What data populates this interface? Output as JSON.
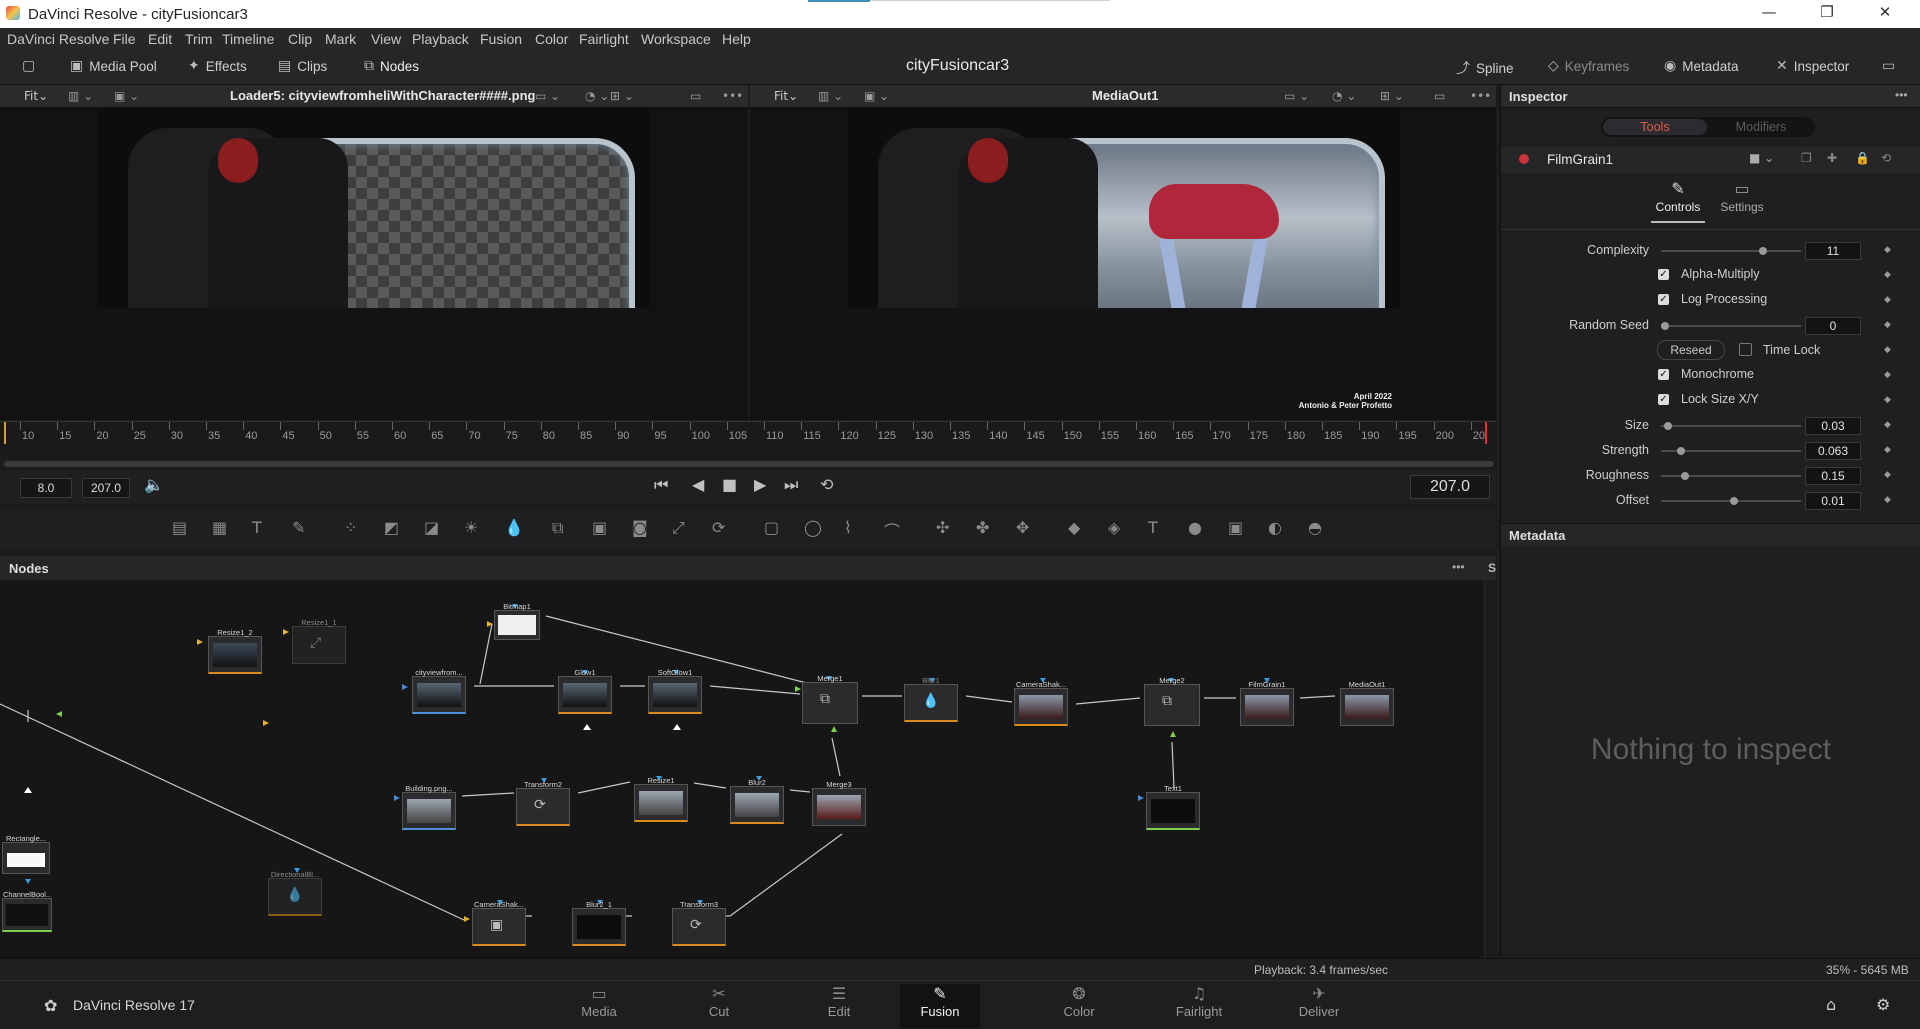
{
  "window": {
    "title": "DaVinci Resolve - cityFusioncar3",
    "minimize": "—",
    "restore": "❐",
    "close": "✕"
  },
  "menu": [
    "DaVinci Resolve",
    "File",
    "Edit",
    "Trim",
    "Timeline",
    "Clip",
    "Mark",
    "View",
    "Playback",
    "Fusion",
    "Color",
    "Fairlight",
    "Workspace",
    "Help"
  ],
  "toolbar": {
    "media_pool": "Media Pool",
    "effects": "Effects",
    "clips": "Clips",
    "nodes": "Nodes",
    "project": "cityFusioncar3",
    "spline": "Spline",
    "keyframes": "Keyframes",
    "metadata": "Metadata",
    "inspector": "Inspector"
  },
  "viewer_left": {
    "fit": "Fit",
    "name": "Loader5: cityviewfromheliWithCharacter####.png"
  },
  "viewer_right": {
    "fit": "Fit",
    "name": "MediaOut1",
    "overlay_line1": "April 2022",
    "overlay_line2": "Antonio & Peter Profetto"
  },
  "ruler": {
    "ticks": [
      "10",
      "15",
      "20",
      "25",
      "30",
      "35",
      "40",
      "45",
      "50",
      "55",
      "60",
      "65",
      "70",
      "75",
      "80",
      "85",
      "90",
      "95",
      "100",
      "105",
      "110",
      "115",
      "120",
      "125",
      "130",
      "135",
      "140",
      "145",
      "150",
      "155",
      "160",
      "165",
      "170",
      "175",
      "180",
      "185",
      "190",
      "195",
      "200",
      "20"
    ]
  },
  "transport": {
    "start": "8.0",
    "end": "207.0",
    "current": "207.0"
  },
  "nodes_panel": {
    "title": "Nodes",
    "more": "•••",
    "side_label": "S"
  },
  "nodes": [
    {
      "id": "Resize1_2"
    },
    {
      "id": "Resize1_1"
    },
    {
      "id": "Bitmap1"
    },
    {
      "id": "cityviewfrom..."
    },
    {
      "id": "Glow1"
    },
    {
      "id": "SoftGlow1"
    },
    {
      "id": "Merge1"
    },
    {
      "id": "Blur1"
    },
    {
      "id": "CameraShak..."
    },
    {
      "id": "Merge2"
    },
    {
      "id": "FilmGrain1"
    },
    {
      "id": "MediaOut1"
    },
    {
      "id": "Building.png..."
    },
    {
      "id": "Transform2"
    },
    {
      "id": "Resize1"
    },
    {
      "id": "Blur2"
    },
    {
      "id": "Merge3"
    },
    {
      "id": "Text1"
    },
    {
      "id": "Rectangle..."
    },
    {
      "id": "ChannelBool..."
    },
    {
      "id": "DirectionalBl..."
    },
    {
      "id": "CameraShak..."
    },
    {
      "id": "Blur2_1"
    },
    {
      "id": "Transform3"
    }
  ],
  "inspector": {
    "title": "Inspector",
    "tab_tools": "Tools",
    "tab_modifiers": "Modifiers",
    "tool_name": "FilmGrain1",
    "subtab_controls": "Controls",
    "subtab_settings": "Settings",
    "complexity_label": "Complexity",
    "complexity_value": "11",
    "alpha_multiply": "Alpha-Multiply",
    "log_processing": "Log Processing",
    "random_seed_label": "Random Seed",
    "random_seed_value": "0",
    "reseed": "Reseed",
    "time_lock": "Time Lock",
    "monochrome": "Monochrome",
    "lock_size": "Lock Size X/Y",
    "size_label": "Size",
    "size_value": "0.03",
    "strength_label": "Strength",
    "strength_value": "0.063",
    "roughness_label": "Roughness",
    "roughness_value": "0.15",
    "offset_label": "Offset",
    "offset_value": "0.01",
    "metadata_title": "Metadata",
    "nothing": "Nothing to inspect"
  },
  "sliders": {
    "complexity": 0.74,
    "random_seed": 0.0,
    "size": 0.02,
    "strength": 0.12,
    "roughness": 0.15,
    "offset": 0.52
  },
  "status": {
    "playback": "Playback: 3.4 frames/sec",
    "memory": "35% - 5645 MB"
  },
  "pages": {
    "app": "DaVinci Resolve 17",
    "media": "Media",
    "cut": "Cut",
    "edit": "Edit",
    "fusion": "Fusion",
    "color": "Color",
    "fairlight": "Fairlight",
    "deliver": "Deliver"
  },
  "colors": {
    "accent_orange": "#d88a1c",
    "active_tab": "#e05a48",
    "green_ruler": "#2c7a2c",
    "playhead": "#d33"
  }
}
